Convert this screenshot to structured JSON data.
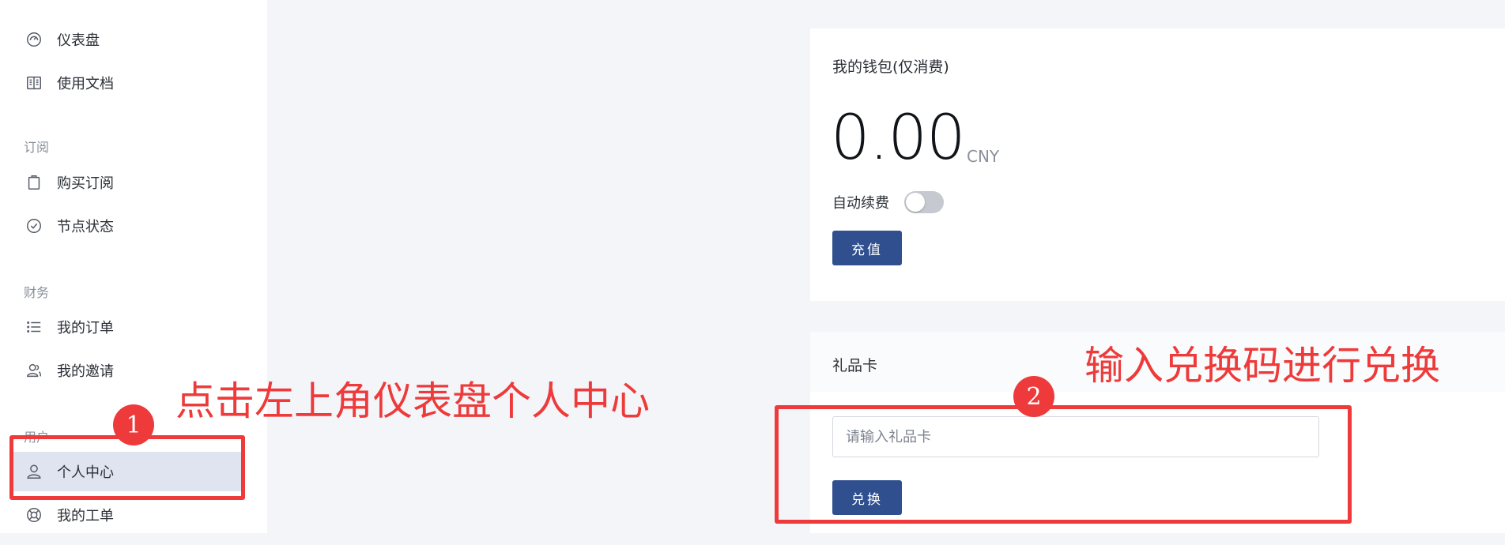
{
  "sidebar": {
    "items": [
      {
        "id": "dashboard",
        "label": "仪表盘",
        "icon": "dashboard-icon"
      },
      {
        "id": "docs",
        "label": "使用文档",
        "icon": "book-icon"
      },
      {
        "id": "buy-subscription",
        "label": "购买订阅",
        "icon": "clipboard-icon"
      },
      {
        "id": "node-status",
        "label": "节点状态",
        "icon": "check-circle-icon"
      },
      {
        "id": "my-orders",
        "label": "我的订单",
        "icon": "list-icon"
      },
      {
        "id": "my-invites",
        "label": "我的邀请",
        "icon": "users-icon"
      },
      {
        "id": "profile",
        "label": "个人中心",
        "icon": "user-icon",
        "active": true
      },
      {
        "id": "my-tickets",
        "label": "我的工单",
        "icon": "lifebuoy-icon"
      }
    ],
    "sections": {
      "subscription": "订阅",
      "finance": "财务",
      "user": "用户"
    }
  },
  "wallet": {
    "title": "我的钱包(仅消费)",
    "amount": "0.00",
    "currency": "CNY",
    "auto_renew_label": "自动续费",
    "auto_renew_enabled": false,
    "recharge_label": "充值"
  },
  "gift_card": {
    "title": "礼品卡",
    "input_placeholder": "请输入礼品卡",
    "input_value": "",
    "redeem_label": "兑换"
  },
  "annotations": {
    "step1_number": "1",
    "step1_text": "点击左上角仪表盘个人中心",
    "step2_number": "2",
    "step2_text": "输入兑换码进行兑换",
    "color": "#ee3a3a"
  },
  "colors": {
    "primary_button": "#2f4f8f",
    "background": "#f3f5f9",
    "active_item": "#dfe4f0"
  }
}
